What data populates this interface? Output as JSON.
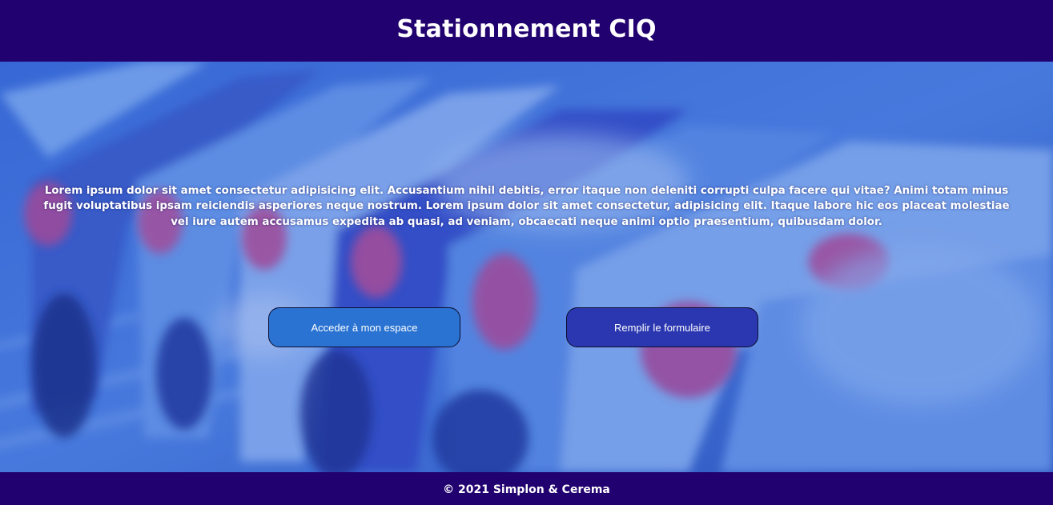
{
  "header": {
    "title": "Stationnement CIQ"
  },
  "hero": {
    "background_image": "blurred-parked-cars-photo",
    "description": "Lorem ipsum dolor sit amet consectetur adipisicing elit. Accusantium nihil debitis, error itaque non deleniti corrupti culpa facere qui vitae? Animi totam minus fugit voluptatibus ipsam reiciendis asperiores neque nostrum. Lorem ipsum dolor sit amet consectetur, adipisicing elit. Itaque labore hic eos placeat molestiae vel iure autem accusamus expedita ab quasi, ad veniam, obcaecati neque animi optio praesentium, quibusdam dolor.",
    "buttons": {
      "access_label": "Acceder à mon espace",
      "form_label": "Remplir le formulaire"
    }
  },
  "footer": {
    "copyright": "© 2021 Simplon & Cerema"
  },
  "colors": {
    "bar_background": "#21006f",
    "access_button": "#2a73d2",
    "form_button": "#2b37b0",
    "hero_tint": "#2f5fc4"
  }
}
